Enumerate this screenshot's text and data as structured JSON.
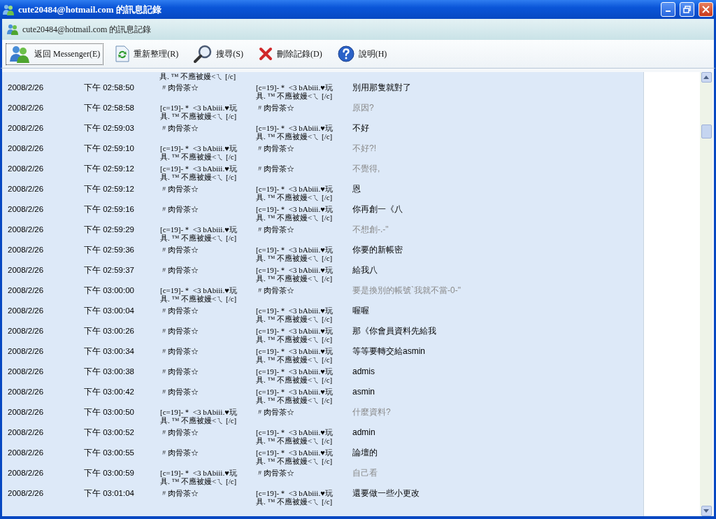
{
  "window": {
    "title": "cute20484@hotmail.com 的訊息記錄"
  },
  "header": {
    "title": "cute20484@hotmail.com 的訊息記錄"
  },
  "toolbar": [
    {
      "label": "返回 Messenger(E)",
      "kind": "back",
      "focused": true
    },
    {
      "label": "重新整理(R)",
      "kind": "refresh",
      "focused": false
    },
    {
      "label": "搜尋(S)",
      "kind": "search",
      "focused": false
    },
    {
      "label": "刪除記錄(D)",
      "kind": "delete",
      "focused": false
    },
    {
      "label": "說明(H)",
      "kind": "help",
      "focused": false
    }
  ],
  "history": {
    "cut_top_text": "具. ™ 不應被嫚<ㄟ [/c]",
    "rows": [
      {
        "date": "2008/2/26",
        "time": "下午 02:58:50",
        "from": "〃肉骨茶☆",
        "to": "[c=19]-＊ <3 bAbiii.♥玩具. ™ 不應被嫚<ㄟ [/c]",
        "message": "別用那隻就對了",
        "faded": false
      },
      {
        "date": "2008/2/26",
        "time": "下午 02:58:58",
        "from": "[c=19]-＊ <3 bAbiii.♥玩具. ™ 不應被嫚<ㄟ [/c]",
        "to": "〃肉骨茶☆",
        "message": "原因?",
        "faded": true
      },
      {
        "date": "2008/2/26",
        "time": "下午 02:59:03",
        "from": "〃肉骨茶☆",
        "to": "[c=19]-＊ <3 bAbiii.♥玩具. ™ 不應被嫚<ㄟ [/c]",
        "message": "不好",
        "faded": false
      },
      {
        "date": "2008/2/26",
        "time": "下午 02:59:10",
        "from": "[c=19]-＊ <3 bAbiii.♥玩具. ™ 不應被嫚<ㄟ [/c]",
        "to": "〃肉骨茶☆",
        "message": "不好?!",
        "faded": true
      },
      {
        "date": "2008/2/26",
        "time": "下午 02:59:12",
        "from": "[c=19]-＊ <3 bAbiii.♥玩具. ™ 不應被嫚<ㄟ [/c]",
        "to": "〃肉骨茶☆",
        "message": "不覺得,",
        "faded": true
      },
      {
        "date": "2008/2/26",
        "time": "下午 02:59:12",
        "from": "〃肉骨茶☆",
        "to": "[c=19]-＊ <3 bAbiii.♥玩具. ™ 不應被嫚<ㄟ [/c]",
        "message": "恩",
        "faded": false
      },
      {
        "date": "2008/2/26",
        "time": "下午 02:59:16",
        "from": "〃肉骨茶☆",
        "to": "[c=19]-＊ <3 bAbiii.♥玩具. ™ 不應被嫚<ㄟ [/c]",
        "message": "你再創一《八",
        "faded": false
      },
      {
        "date": "2008/2/26",
        "time": "下午 02:59:29",
        "from": "[c=19]-＊ <3 bAbiii.♥玩具. ™ 不應被嫚<ㄟ [/c]",
        "to": "〃肉骨茶☆",
        "message": "不想創-.-\"",
        "faded": true
      },
      {
        "date": "2008/2/26",
        "time": "下午 02:59:36",
        "from": "〃肉骨茶☆",
        "to": "[c=19]-＊ <3 bAbiii.♥玩具. ™ 不應被嫚<ㄟ [/c]",
        "message": "你要的新帳密",
        "faded": false
      },
      {
        "date": "2008/2/26",
        "time": "下午 02:59:37",
        "from": "〃肉骨茶☆",
        "to": "[c=19]-＊ <3 bAbiii.♥玩具. ™ 不應被嫚<ㄟ [/c]",
        "message": "給我八",
        "faded": false
      },
      {
        "date": "2008/2/26",
        "time": "下午 03:00:00",
        "from": "[c=19]-＊ <3 bAbiii.♥玩具. ™ 不應被嫚<ㄟ [/c]",
        "to": "〃肉骨茶☆",
        "message": "要是換別的帳號`我就不當-0-\"",
        "faded": true
      },
      {
        "date": "2008/2/26",
        "time": "下午 03:00:04",
        "from": "〃肉骨茶☆",
        "to": "[c=19]-＊ <3 bAbiii.♥玩具. ™ 不應被嫚<ㄟ [/c]",
        "message": "喔喔",
        "faded": false
      },
      {
        "date": "2008/2/26",
        "time": "下午 03:00:26",
        "from": "〃肉骨茶☆",
        "to": "[c=19]-＊ <3 bAbiii.♥玩具. ™ 不應被嫚<ㄟ [/c]",
        "message": "那《你會員資料先給我",
        "faded": false
      },
      {
        "date": "2008/2/26",
        "time": "下午 03:00:34",
        "from": "〃肉骨茶☆",
        "to": "[c=19]-＊ <3 bAbiii.♥玩具. ™ 不應被嫚<ㄟ [/c]",
        "message": "等等要轉交給asmin",
        "faded": false
      },
      {
        "date": "2008/2/26",
        "time": "下午 03:00:38",
        "from": "〃肉骨茶☆",
        "to": "[c=19]-＊ <3 bAbiii.♥玩具. ™ 不應被嫚<ㄟ [/c]",
        "message": "admis",
        "faded": false
      },
      {
        "date": "2008/2/26",
        "time": "下午 03:00:42",
        "from": "〃肉骨茶☆",
        "to": "[c=19]-＊ <3 bAbiii.♥玩具. ™ 不應被嫚<ㄟ [/c]",
        "message": "asmin",
        "faded": false
      },
      {
        "date": "2008/2/26",
        "time": "下午 03:00:50",
        "from": "[c=19]-＊ <3 bAbiii.♥玩具. ™ 不應被嫚<ㄟ [/c]",
        "to": "〃肉骨茶☆",
        "message": "什麼資料?",
        "faded": true
      },
      {
        "date": "2008/2/26",
        "time": "下午 03:00:52",
        "from": "〃肉骨茶☆",
        "to": "[c=19]-＊ <3 bAbiii.♥玩具. ™ 不應被嫚<ㄟ [/c]",
        "message": "admin",
        "faded": false
      },
      {
        "date": "2008/2/26",
        "time": "下午 03:00:55",
        "from": "〃肉骨茶☆",
        "to": "[c=19]-＊ <3 bAbiii.♥玩具. ™ 不應被嫚<ㄟ [/c]",
        "message": "論壇的",
        "faded": false
      },
      {
        "date": "2008/2/26",
        "time": "下午 03:00:59",
        "from": "[c=19]-＊ <3 bAbiii.♥玩具. ™ 不應被嫚<ㄟ [/c]",
        "to": "〃肉骨茶☆",
        "message": "自己看",
        "faded": true
      },
      {
        "date": "2008/2/26",
        "time": "下午 03:01:04",
        "from": "〃肉骨茶☆",
        "to": "[c=19]-＊ <3 bAbiii.♥玩具. ™ 不應被嫚<ㄟ [/c]",
        "message": "還要做一些小更改",
        "faded": false
      }
    ]
  }
}
